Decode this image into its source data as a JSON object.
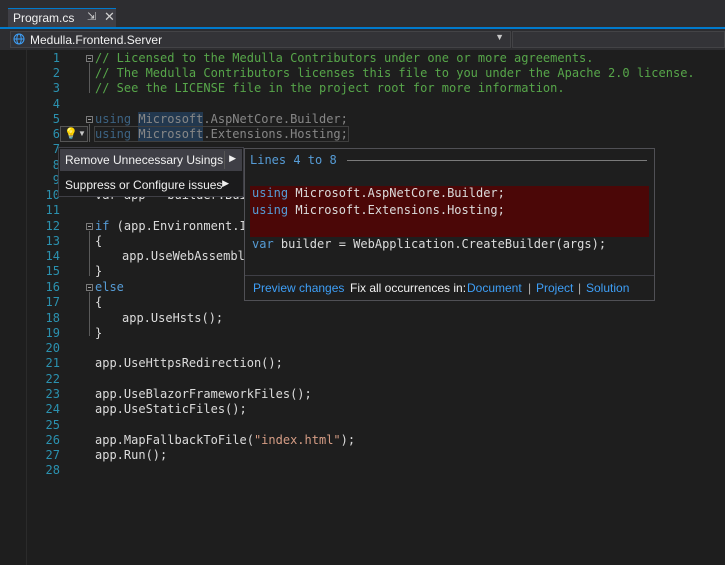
{
  "tab": {
    "title": "Program.cs",
    "pin_icon": "pin-icon",
    "close_icon": "close-icon"
  },
  "navbar": {
    "project": "Medulla.Frontend.Server",
    "project_icon": "globe-icon",
    "member": ""
  },
  "editor": {
    "lines": [
      {
        "n": "1"
      },
      {
        "n": "2"
      },
      {
        "n": "3"
      },
      {
        "n": "4"
      },
      {
        "n": "5"
      },
      {
        "n": "6"
      },
      {
        "n": "7"
      },
      {
        "n": "8"
      },
      {
        "n": "9"
      },
      {
        "n": "10"
      },
      {
        "n": "11"
      },
      {
        "n": "12"
      },
      {
        "n": "13"
      },
      {
        "n": "14"
      },
      {
        "n": "15"
      },
      {
        "n": "16"
      },
      {
        "n": "17"
      },
      {
        "n": "18"
      },
      {
        "n": "19"
      },
      {
        "n": "20"
      },
      {
        "n": "21"
      },
      {
        "n": "22"
      },
      {
        "n": "23"
      },
      {
        "n": "24"
      },
      {
        "n": "25"
      },
      {
        "n": "26"
      },
      {
        "n": "27"
      },
      {
        "n": "28"
      }
    ],
    "comment1": "// Licensed to the Medulla Contributors under one or more agreements.",
    "comment2": "// The Medulla Contributors licenses this file to you under the Apache 2.0 license.",
    "comment3": "// See the LICENSE file in the project root for more information.",
    "kw_using": "using",
    "ns_microsoft": "Microsoft",
    "ns_rest1": ".AspNetCore.Builder;",
    "ns_rest2": ".Extensions.Hosting;",
    "line10_partial": "var app = builder.Bui",
    "kw_if": "if",
    "line12_rest": " (app.Environment.Is",
    "brace_open": "{",
    "brace_close": "}",
    "line14": "app.UseWebAssembly",
    "kw_else": "else",
    "line19": "app.UseHsts();",
    "line22": "app.UseHttpsRedirection();",
    "line24": "app.UseBlazorFrameworkFiles();",
    "line25": "app.UseStaticFiles();",
    "line27_pre": "app.MapFallbackToFile(",
    "line27_str": "\"index.html\"",
    "line27_post": ");",
    "line28": "app.Run();"
  },
  "quick_actions": {
    "bulb_icon": "lightbulb-icon",
    "items": [
      {
        "label": "Remove Unnecessary Usings"
      },
      {
        "label": "Suppress or Configure issues"
      }
    ]
  },
  "preview": {
    "title": "Lines 4 to 8",
    "del1_kw": "using",
    "del1_rest": " Microsoft.AspNetCore.Builder;",
    "del2_kw": "using",
    "del2_rest": " Microsoft.Extensions.Hosting;",
    "kept_kw": "var",
    "kept_mid": " builder = ",
    "kept_type": "WebApplication",
    "kept_rest": ".CreateBuilder(args);",
    "footer": {
      "preview_link": "Preview changes",
      "fix_all": "Fix all occurrences in:",
      "document": "Document",
      "project": "Project",
      "solution": "Solution",
      "separator": "|"
    }
  }
}
